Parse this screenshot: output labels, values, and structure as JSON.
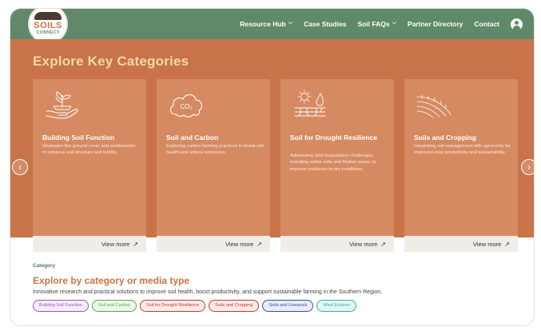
{
  "logo": {
    "main": "SOILS",
    "sub": "CONNECT"
  },
  "nav": {
    "items": [
      {
        "label": "Resource Hub",
        "dropdown": true
      },
      {
        "label": "Case Studies",
        "dropdown": false
      },
      {
        "label": "Soil FAQs",
        "dropdown": true
      },
      {
        "label": "Partner Directory",
        "dropdown": false
      },
      {
        "label": "Contact",
        "dropdown": false
      }
    ],
    "chevron": "⌵"
  },
  "hero": {
    "title": "Explore Key Categories",
    "cards": [
      {
        "icon": "hands-plant-icon",
        "title": "Building Soil Function",
        "description": "Strategies like ground cover and amelioration to enhance soil structure and fertility.",
        "button": "View more"
      },
      {
        "icon": "co2-cloud-icon",
        "title": "Soil and Carbon",
        "description": "Exploring carbon farming practices to boost soil health and reduce emissions.",
        "button": "View more"
      },
      {
        "icon": "drought-sun-icon",
        "title": "Soil for Drought Resilience",
        "description": "Addressing land degradation challenges, including saline soils and Mallee seeps, to improve resilience to dry conditions.",
        "button": "View more"
      },
      {
        "icon": "crop-rows-icon",
        "title": "Soils and Cropping",
        "description": "Integrating soil management with agronomy for improved crop productivity and sustainability.",
        "button": "View more"
      }
    ],
    "arrow_glyph": "↗",
    "prev_glyph": "‹",
    "next_glyph": "›"
  },
  "category": {
    "label": "Category",
    "title": "Explore by category or media type",
    "description": "Innovative research and practical solutions to improve soil health, boost productivity, and support sustainable farming in the Southern Region.",
    "chips": [
      {
        "label": "Building Soil Function",
        "color": "#9b59b6",
        "bg": "#f6ecfb"
      },
      {
        "label": "Soil and Carbon",
        "color": "#5aa84a",
        "bg": "#eef8ea"
      },
      {
        "label": "Soil for Drought Resilience",
        "color": "#c0392b",
        "bg": "#fcebea"
      },
      {
        "label": "Soils and Cropping",
        "color": "#c0392b",
        "bg": "#fcebea"
      },
      {
        "label": "Soils and Livestock",
        "color": "#3b4aa8",
        "bg": "#e9ecf9"
      },
      {
        "label": "Wind Erosion",
        "color": "#36b0a0",
        "bg": "#e3f6f3"
      }
    ]
  },
  "colors": {
    "nav": "#5f8a6a",
    "hero": "#c8734a",
    "card": "#d68a62",
    "title_accent": "#f1d9a4",
    "brand_orange": "#c8743f"
  }
}
